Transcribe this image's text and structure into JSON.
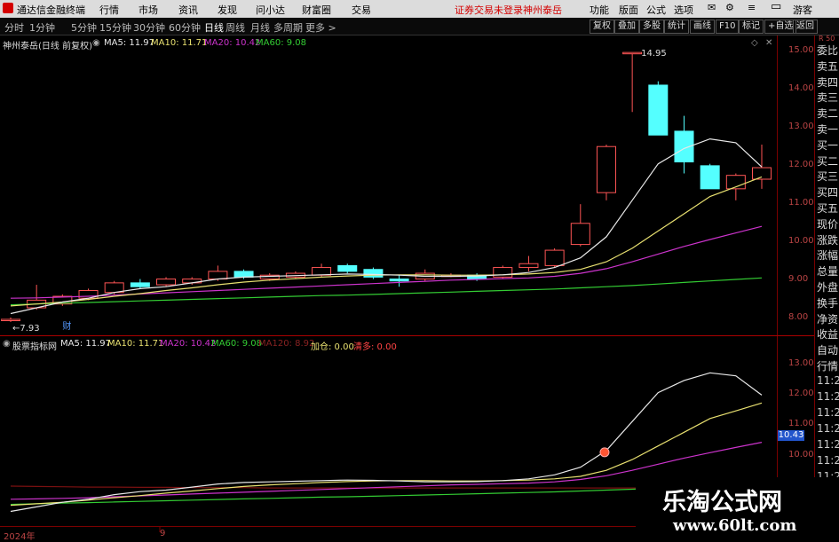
{
  "menubar": {
    "app_title": "通达信金融终端",
    "items": [
      "行情",
      "市场",
      "资讯",
      "发现",
      "问小达",
      "财富圈",
      "交易"
    ],
    "notice": "证券交易未登录",
    "stock": "神州泰岳",
    "right_items": [
      "功能",
      "版面",
      "公式",
      "选项"
    ],
    "guest": "游客"
  },
  "periodbar": {
    "periods": [
      "分时",
      "1分钟",
      "5分钟",
      "15分钟",
      "30分钟",
      "60分钟",
      "日线",
      "周线",
      "月线",
      "多周期",
      "更多 >"
    ],
    "active_index": 6,
    "tools": [
      "复权",
      "叠加",
      "多股",
      "统计",
      "画线",
      "F10",
      "标记",
      "+自选",
      "返回"
    ]
  },
  "main_chart": {
    "title": "神州泰岳(日线 前复权)",
    "ma5_label": "MA5: 11.97",
    "ma10_label": "MA10: 11.71",
    "ma20_label": "MA20: 10.42",
    "ma60_label": "MA60: 9.08",
    "high_label": "14.95",
    "low_label": "7.93",
    "cai_label": "财",
    "y_ticks": [
      "15.00",
      "14.00",
      "13.00",
      "12.00",
      "11.00",
      "10.00",
      "9.00",
      "8.00"
    ],
    "right_top": "R 50"
  },
  "indicator": {
    "title": "股票指标网",
    "ma5_label": "MA5: 11.97",
    "ma10_label": "MA10: 11.71",
    "ma20_label": "MA20: 10.42",
    "ma60_label": "MA60: 9.08",
    "ma120_label": "MA120: 8.92",
    "jiacang_label": "加仓: 0.00",
    "qingduo_label": "清多: 0.00",
    "y_ticks": [
      "13.00",
      "12.00",
      "11.00",
      "10.00"
    ],
    "current_value": "10.43"
  },
  "right_sidebar": {
    "items": [
      "委比",
      "卖五",
      "卖四",
      "卖三",
      "卖二",
      "卖一",
      "买一",
      "买二",
      "买三",
      "买四",
      "买五",
      "现价",
      "涨跌",
      "涨幅",
      "总量",
      "外盘",
      "换手",
      "净资",
      "收益"
    ],
    "bottom_items": [
      "自动",
      "行情",
      "11:28",
      "11:28",
      "11:28",
      "11:28",
      "11:28",
      "11:28",
      "11:28",
      "11:28",
      "11:28"
    ]
  },
  "timeline": {
    "year_label": "2024年",
    "month_label": "9"
  },
  "watermark": {
    "title": "乐淘公式网",
    "url": "www.60lt.com"
  },
  "colors": {
    "up": "#ff5555",
    "down": "#54ffff",
    "ma5": "#e8e8e8",
    "ma10": "#e8e070",
    "ma20": "#cc33cc",
    "ma60": "#33cc33",
    "grid": "#7a0000",
    "axis_text": "#b44444"
  },
  "chart_data": {
    "type": "candlestick",
    "price_range": [
      7.7,
      15.3
    ],
    "candles": [
      {
        "o": 7.98,
        "h": 8.05,
        "l": 7.93,
        "c": 8.0
      },
      {
        "o": 8.3,
        "h": 8.9,
        "l": 8.25,
        "c": 8.5
      },
      {
        "o": 8.4,
        "h": 8.65,
        "l": 8.35,
        "c": 8.6
      },
      {
        "o": 8.55,
        "h": 8.8,
        "l": 8.5,
        "c": 8.75
      },
      {
        "o": 8.7,
        "h": 9.0,
        "l": 8.65,
        "c": 8.95
      },
      {
        "o": 8.95,
        "h": 9.05,
        "l": 8.8,
        "c": 8.85
      },
      {
        "o": 8.9,
        "h": 9.1,
        "l": 8.85,
        "c": 9.05
      },
      {
        "o": 8.95,
        "h": 9.1,
        "l": 8.9,
        "c": 9.05
      },
      {
        "o": 9.05,
        "h": 9.4,
        "l": 9.0,
        "c": 9.25
      },
      {
        "o": 9.25,
        "h": 9.3,
        "l": 9.05,
        "c": 9.1
      },
      {
        "o": 9.05,
        "h": 9.2,
        "l": 9.0,
        "c": 9.15
      },
      {
        "o": 9.1,
        "h": 9.25,
        "l": 9.05,
        "c": 9.2
      },
      {
        "o": 9.15,
        "h": 9.45,
        "l": 9.1,
        "c": 9.35
      },
      {
        "o": 9.4,
        "h": 9.45,
        "l": 9.2,
        "c": 9.25
      },
      {
        "o": 9.3,
        "h": 9.35,
        "l": 9.05,
        "c": 9.1
      },
      {
        "o": 9.05,
        "h": 9.15,
        "l": 8.85,
        "c": 9.0
      },
      {
        "o": 9.05,
        "h": 9.3,
        "l": 9.0,
        "c": 9.2
      },
      {
        "o": 9.15,
        "h": 9.2,
        "l": 9.1,
        "c": 9.15
      },
      {
        "o": 9.15,
        "h": 9.2,
        "l": 9.0,
        "c": 9.05
      },
      {
        "o": 9.1,
        "h": 9.4,
        "l": 9.05,
        "c": 9.35
      },
      {
        "o": 9.35,
        "h": 9.65,
        "l": 9.25,
        "c": 9.45
      },
      {
        "o": 9.4,
        "h": 9.85,
        "l": 9.35,
        "c": 9.8
      },
      {
        "o": 9.95,
        "h": 11.0,
        "l": 9.9,
        "c": 10.5
      },
      {
        "o": 11.3,
        "h": 12.55,
        "l": 11.1,
        "c": 12.5
      },
      {
        "o": 14.95,
        "h": 14.95,
        "l": 13.4,
        "c": 14.95
      },
      {
        "o": 14.1,
        "h": 14.2,
        "l": 12.8,
        "c": 12.8
      },
      {
        "o": 12.9,
        "h": 13.3,
        "l": 11.8,
        "c": 12.1
      },
      {
        "o": 12.0,
        "h": 12.05,
        "l": 11.4,
        "c": 11.4
      },
      {
        "o": 11.4,
        "h": 11.8,
        "l": 11.1,
        "c": 11.75
      },
      {
        "o": 11.65,
        "h": 12.55,
        "l": 11.4,
        "c": 11.95
      }
    ],
    "ma5": [
      8.15,
      8.3,
      8.45,
      8.55,
      8.7,
      8.8,
      8.85,
      8.95,
      9.05,
      9.1,
      9.12,
      9.14,
      9.16,
      9.18,
      9.17,
      9.15,
      9.12,
      9.12,
      9.13,
      9.16,
      9.22,
      9.35,
      9.6,
      10.15,
      11.1,
      12.05,
      12.45,
      12.7,
      12.6,
      11.97
    ],
    "ma10": [
      8.35,
      8.4,
      8.45,
      8.52,
      8.6,
      8.67,
      8.75,
      8.82,
      8.9,
      8.97,
      9.02,
      9.06,
      9.1,
      9.13,
      9.15,
      9.16,
      9.16,
      9.15,
      9.15,
      9.16,
      9.18,
      9.22,
      9.3,
      9.5,
      9.85,
      10.3,
      10.75,
      11.2,
      11.45,
      11.71
    ],
    "ma20": [
      8.55,
      8.56,
      8.58,
      8.6,
      8.63,
      8.66,
      8.69,
      8.72,
      8.75,
      8.78,
      8.81,
      8.84,
      8.87,
      8.9,
      8.93,
      8.96,
      8.99,
      9.02,
      9.04,
      9.06,
      9.08,
      9.12,
      9.2,
      9.32,
      9.5,
      9.7,
      9.9,
      10.08,
      10.25,
      10.42
    ],
    "ma60": [
      8.38,
      8.4,
      8.42,
      8.44,
      8.46,
      8.48,
      8.5,
      8.52,
      8.54,
      8.56,
      8.58,
      8.6,
      8.62,
      8.63,
      8.65,
      8.67,
      8.69,
      8.71,
      8.73,
      8.75,
      8.77,
      8.79,
      8.82,
      8.85,
      8.88,
      8.92,
      8.96,
      9.0,
      9.04,
      9.08
    ],
    "ma120": [
      8.98,
      8.97,
      8.96,
      8.95,
      8.95,
      8.94,
      8.94,
      8.93,
      8.93,
      8.93,
      8.92,
      8.92,
      8.92,
      8.92,
      8.92,
      8.92,
      8.92,
      8.92,
      8.92,
      8.92,
      8.92,
      8.92,
      8.92,
      8.92,
      8.92,
      8.92,
      8.92,
      8.92,
      8.92,
      8.92
    ],
    "indicator_range": [
      8.45,
      13.5
    ],
    "signal_index": 23
  }
}
